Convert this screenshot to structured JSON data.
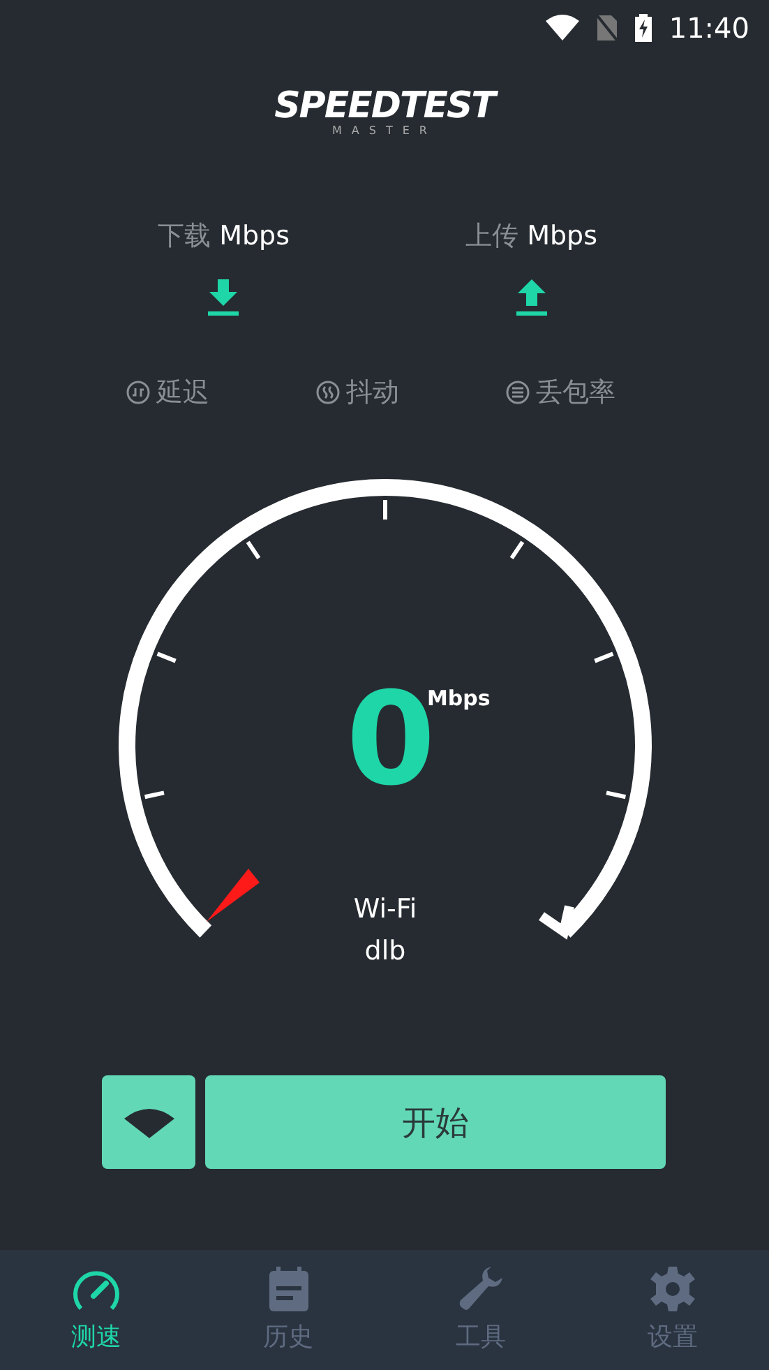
{
  "status_bar": {
    "time": "11:40"
  },
  "logo": {
    "title": "SPEEDTEST",
    "subtitle": "MASTER"
  },
  "results": [
    {
      "kind": "download",
      "label": "下载",
      "unit": "Mbps"
    },
    {
      "kind": "upload",
      "label": "上传",
      "unit": "Mbps"
    }
  ],
  "metrics": [
    {
      "kind": "latency",
      "label": "延迟"
    },
    {
      "kind": "jitter",
      "label": "抖动"
    },
    {
      "kind": "loss",
      "label": "丢包率"
    }
  ],
  "gauge": {
    "value": "0",
    "unit": "Mbps",
    "network": "Wi-Fi",
    "name": "dlb"
  },
  "start_button": "开始",
  "tabs": [
    {
      "kind": "speed",
      "label": "测速",
      "selected": true
    },
    {
      "kind": "history",
      "label": "历史",
      "selected": false
    },
    {
      "kind": "tools",
      "label": "工具",
      "selected": false
    },
    {
      "kind": "settings",
      "label": "设置",
      "selected": false
    }
  ]
}
